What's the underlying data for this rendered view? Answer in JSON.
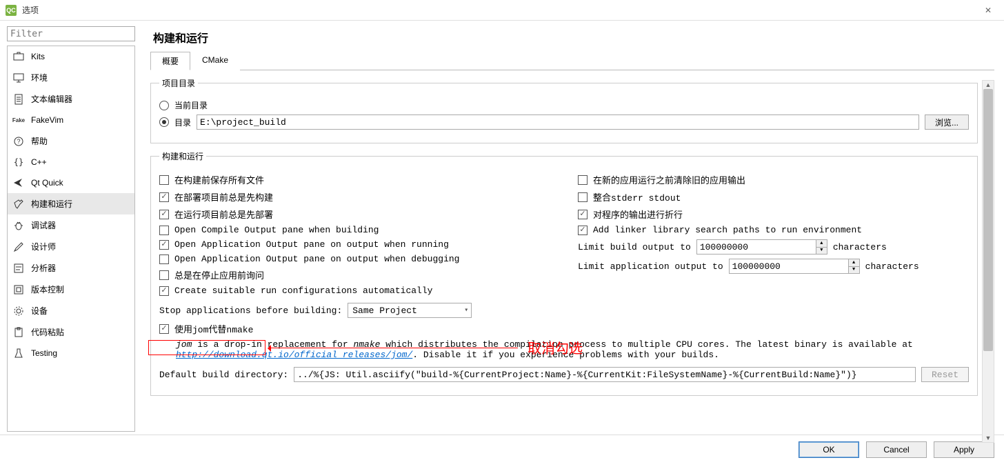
{
  "window": {
    "title": "选项",
    "logo": "QC"
  },
  "filter_placeholder": "Filter",
  "sidebar": {
    "items": [
      {
        "label": "Kits"
      },
      {
        "label": "环境"
      },
      {
        "label": "文本编辑器"
      },
      {
        "label": "FakeVim"
      },
      {
        "label": "帮助"
      },
      {
        "label": "C++"
      },
      {
        "label": "Qt Quick"
      },
      {
        "label": "构建和运行"
      },
      {
        "label": "调试器"
      },
      {
        "label": "设计师"
      },
      {
        "label": "分析器"
      },
      {
        "label": "版本控制"
      },
      {
        "label": "设备"
      },
      {
        "label": "代码粘贴"
      },
      {
        "label": "Testing"
      }
    ]
  },
  "page_title": "构建和运行",
  "tabs": {
    "t0": "概要",
    "t1": "CMake"
  },
  "groups": {
    "project_dir": {
      "legend": "项目目录",
      "radio_current": "当前目录",
      "radio_dir": "目录",
      "dir_value": "E:\\project_build",
      "browse": "浏览..."
    },
    "build_run": {
      "legend": "构建和运行",
      "left": {
        "c0": "在构建前保存所有文件",
        "c1": "在部署项目前总是先构建",
        "c2": "在运行项目前总是先部署",
        "c3": "Open Compile Output pane when building",
        "c4": "Open Application Output pane on output when running",
        "c5": "Open Application Output pane on output when debugging",
        "c6": "总是在停止应用前询问",
        "c7": "Create suitable run configurations automatically"
      },
      "right": {
        "c0": "在新的应用运行之前清除旧的应用输出",
        "c1": "整合stderr stdout",
        "c2": "对程序的输出进行折行",
        "c3": "Add linker library search paths to run environment",
        "limit_build_label": "Limit build output to",
        "limit_build_value": "100000000",
        "limit_app_label": "Limit application output to",
        "limit_app_value": "100000000",
        "chars": "characters"
      },
      "stop_apps_label": "Stop applications before building:",
      "stop_apps_value": "Same Project",
      "use_jom": "使用jom代替nmake",
      "jom_desc_1": "jom",
      "jom_desc_2": " is a drop-in replacement for ",
      "jom_desc_3": "nmake",
      "jom_desc_4": " which distributes the compilation process to multiple CPU cores. The latest binary is available at ",
      "jom_link": "http://download.qt.io/official_releases/jom/",
      "jom_desc_5": ". Disable it if you experience problems with your builds.",
      "default_dir_label": "Default build directory:",
      "default_dir_value": "../%{JS: Util.asciify(\"build-%{CurrentProject:Name}-%{CurrentKit:FileSystemName}-%{CurrentBuild:Name}\")}",
      "reset": "Reset"
    }
  },
  "annotation": "取消勾选",
  "footer": {
    "ok": "OK",
    "cancel": "Cancel",
    "apply": "Apply"
  }
}
